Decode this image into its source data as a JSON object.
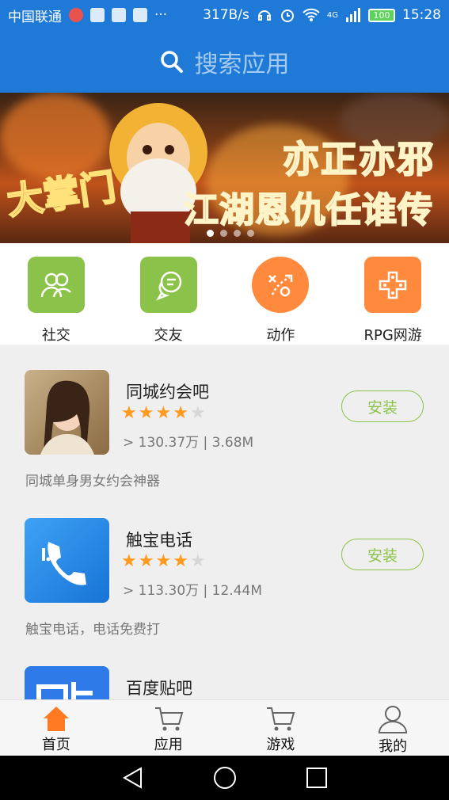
{
  "status_bar": {
    "carrier": "中国联通",
    "network_speed": "317B/s",
    "network_type": "4G",
    "battery": "100",
    "time": "15:28"
  },
  "search": {
    "placeholder": "搜索应用"
  },
  "banner": {
    "title_line1": "亦正亦邪",
    "title_line2": "江湖恩仇任谁传",
    "game_logo": "大掌门",
    "slides": 4,
    "active_slide": 1
  },
  "categories": [
    {
      "label": "社交",
      "icon": "people-icon",
      "color": "#8bc34a"
    },
    {
      "label": "交友",
      "icon": "chat-icon",
      "color": "#8bc34a"
    },
    {
      "label": "动作",
      "icon": "tactics-icon",
      "color": "#ff8a3d"
    },
    {
      "label": "RPG网游",
      "icon": "gamepad-icon",
      "color": "#ff8a3d"
    }
  ],
  "apps": [
    {
      "name": "同城约会吧",
      "rating": 4,
      "meta": "> 130.37万 | 3.68M",
      "install_label": "安装",
      "description": "同城单身男女约会神器",
      "icon": "portrait-icon"
    },
    {
      "name": "触宝电话",
      "rating": 4,
      "meta": "> 113.30万 | 12.44M",
      "install_label": "安装",
      "description": "触宝电话，电话免费打",
      "icon": "phone-icon"
    },
    {
      "name": "百度贴吧",
      "icon": "tieba-icon"
    }
  ],
  "bottom_nav": [
    {
      "label": "首页",
      "icon": "home-icon",
      "active": true
    },
    {
      "label": "应用",
      "icon": "cart-icon"
    },
    {
      "label": "游戏",
      "icon": "cart-icon"
    },
    {
      "label": "我的",
      "icon": "user-icon"
    }
  ],
  "colors": {
    "primary": "#1e7ad6",
    "accent_green": "#8bc34a",
    "accent_orange": "#ff8a3d",
    "star": "#ff9a1f"
  }
}
